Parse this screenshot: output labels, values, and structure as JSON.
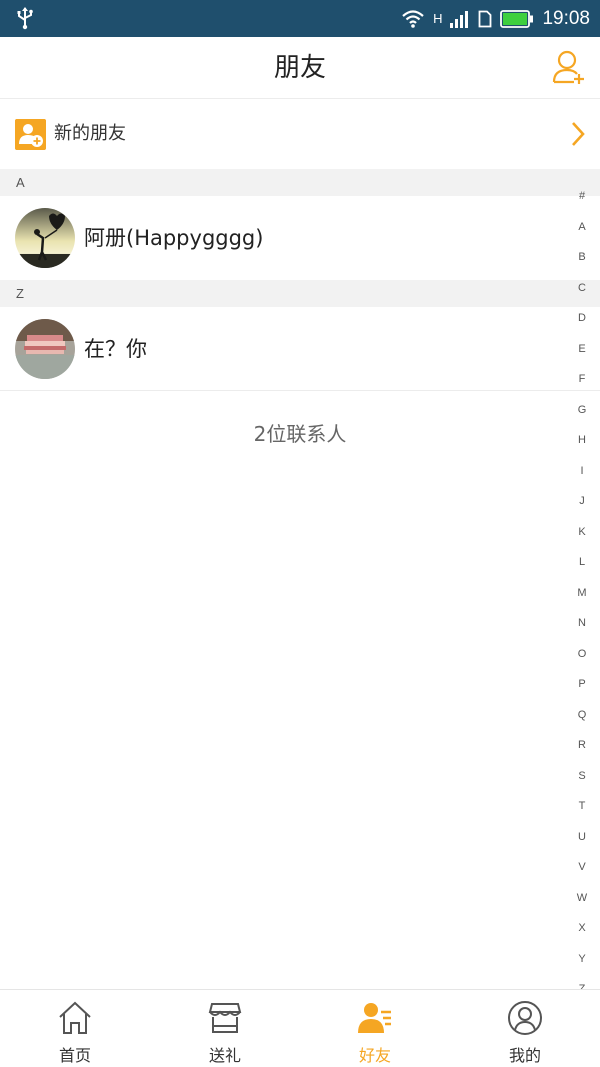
{
  "status_bar": {
    "network_label": "H",
    "time": "19:08",
    "icons": [
      "usb-icon",
      "wifi-icon",
      "signal-icon",
      "sim-icon",
      "battery-icon"
    ]
  },
  "header": {
    "title": "朋友",
    "add_friend_icon": "add-user-icon"
  },
  "new_friends": {
    "label": "新的朋友",
    "icon": "new-friend-icon"
  },
  "sections": [
    {
      "letter": "A",
      "contacts": [
        {
          "name": "阿册(Happygggg)"
        }
      ]
    },
    {
      "letter": "Z",
      "contacts": [
        {
          "name": "在？你"
        }
      ]
    }
  ],
  "contact_count": "2位联系人",
  "alphabet_index": [
    "#",
    "A",
    "B",
    "C",
    "D",
    "E",
    "F",
    "G",
    "H",
    "I",
    "J",
    "K",
    "L",
    "M",
    "N",
    "O",
    "P",
    "Q",
    "R",
    "S",
    "T",
    "U",
    "V",
    "W",
    "X",
    "Y",
    "Z"
  ],
  "bottom_nav": {
    "active": "好友",
    "tabs": [
      {
        "label": "首页",
        "icon": "home-icon"
      },
      {
        "label": "送礼",
        "icon": "shop-icon"
      },
      {
        "label": "好友",
        "icon": "friends-icon"
      },
      {
        "label": "我的",
        "icon": "profile-icon"
      }
    ]
  },
  "colors": {
    "status_bar": "#1f4f6d",
    "accent": "#f5a623",
    "battery": "#3ecf3e"
  }
}
